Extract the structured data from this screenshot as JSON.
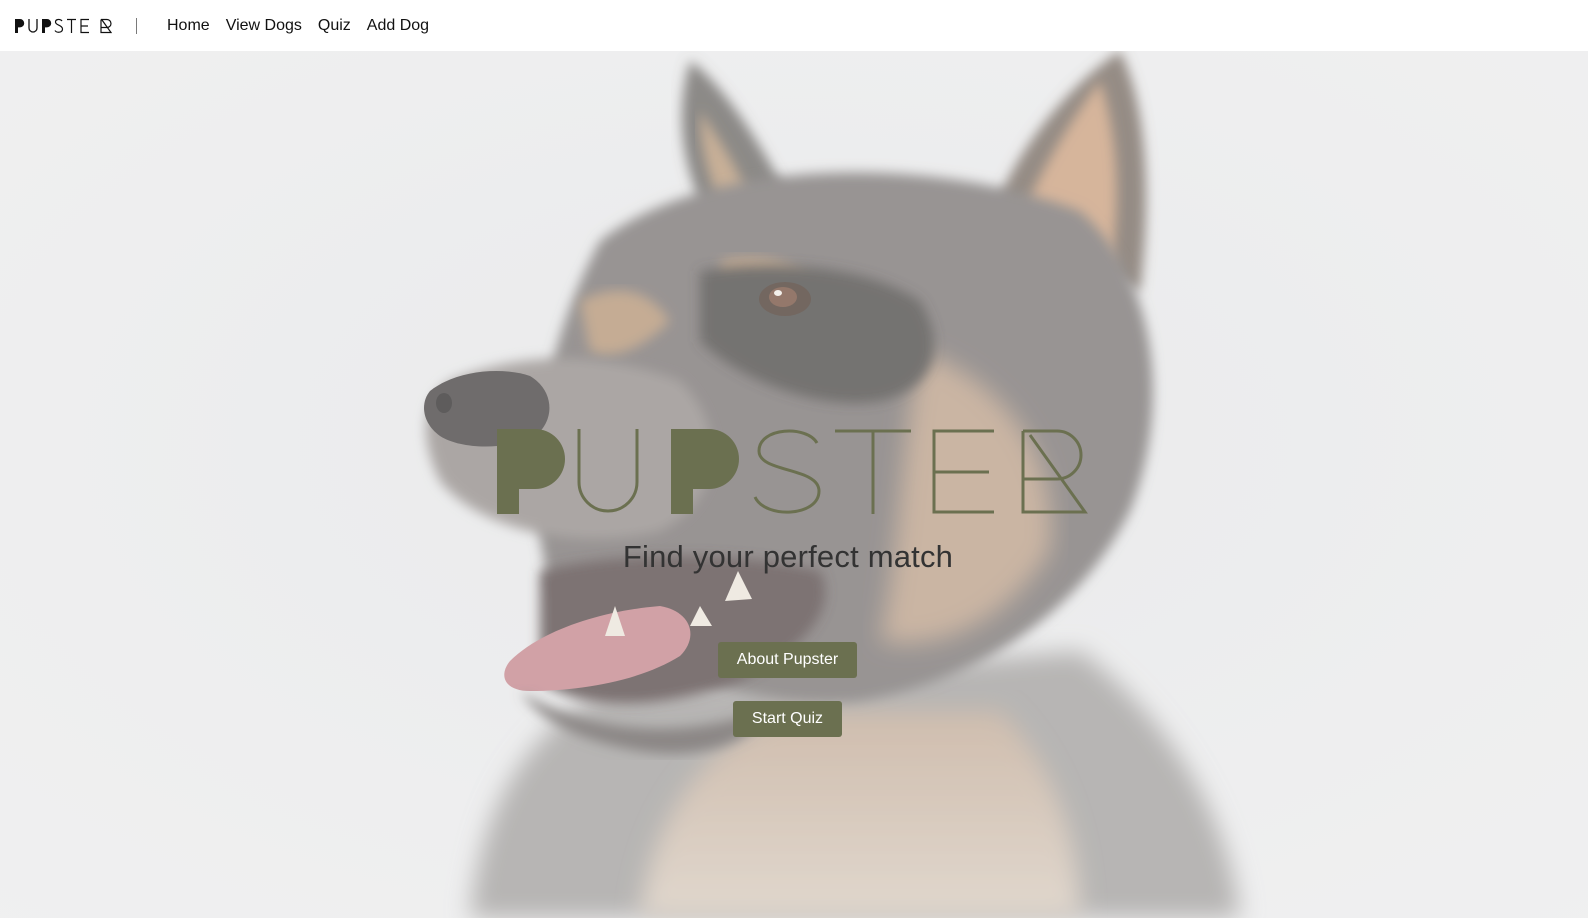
{
  "brand": {
    "logo_text": "PUPSTER",
    "accent_color": "#6b7050",
    "icon": "pupster-wordmark-logo"
  },
  "nav": {
    "items": [
      {
        "label": "Home"
      },
      {
        "label": "View Dogs"
      },
      {
        "label": "Quiz"
      },
      {
        "label": "Add Dog"
      }
    ]
  },
  "hero": {
    "background_image": "dog-portrait-photo",
    "logo_text": "PUPSTER",
    "tagline": "Find your perfect match",
    "buttons": {
      "about_label": "About Pupster",
      "quiz_label": "Start Quiz"
    }
  }
}
